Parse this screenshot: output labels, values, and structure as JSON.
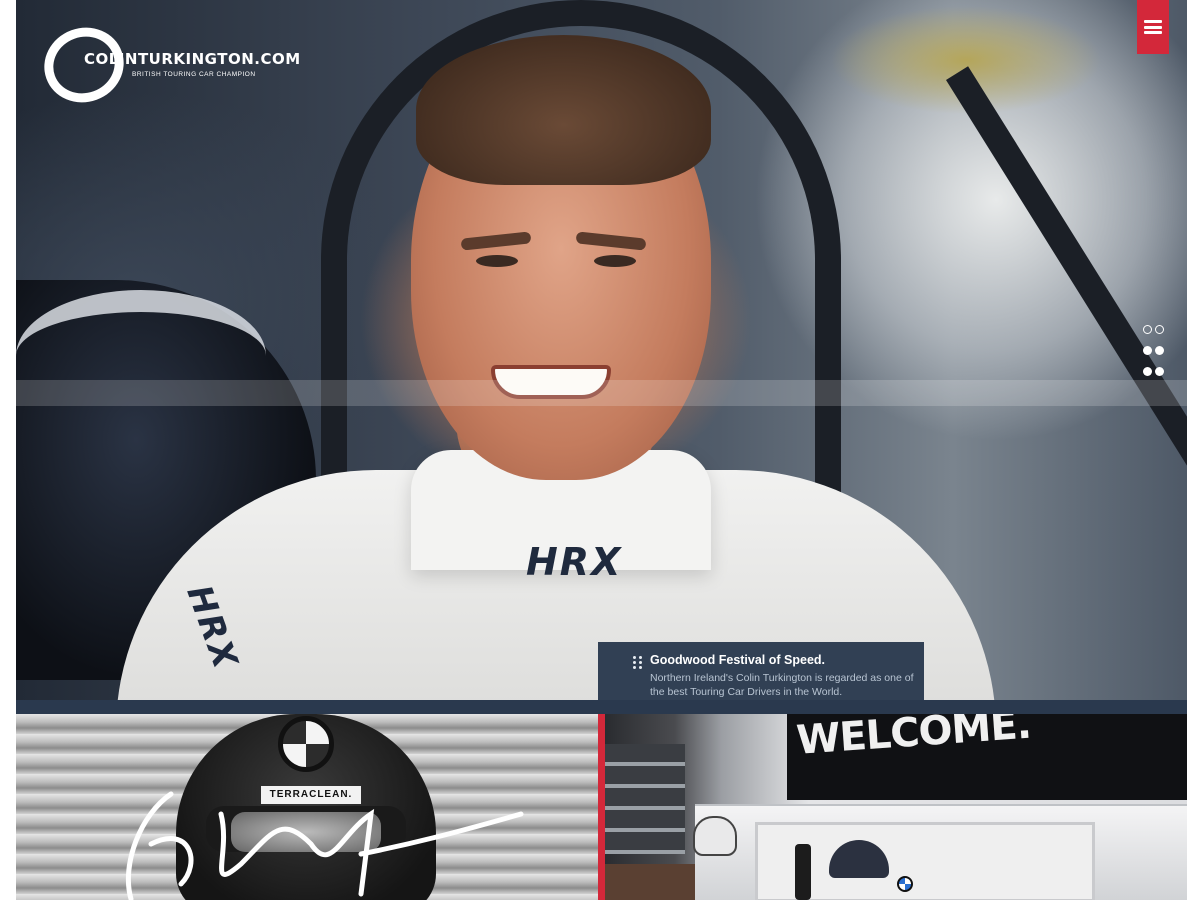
{
  "brand": {
    "name": "COLINTURKINGTON.COM",
    "tagline": "BRITISH TOURING CAR CHAMPION"
  },
  "hero": {
    "suit_logo_collar": "HRX",
    "suit_logo_shoulder": "HRX"
  },
  "menu": {
    "icon": "hamburger-menu-icon"
  },
  "slider_dots": {
    "count": 6,
    "active_index": 0
  },
  "caption": {
    "title": "Goodwood Festival of Speed.",
    "body": "Northern Ireland's Colin Turkington is regarded as one of the best Touring Car Drivers in the World."
  },
  "tiles": {
    "left": {
      "sponsor": "TERRACLEAN."
    },
    "right": {
      "sign": "WELCOME."
    }
  },
  "colors": {
    "accent_red": "#d3283a",
    "navy": "#2a394e"
  }
}
